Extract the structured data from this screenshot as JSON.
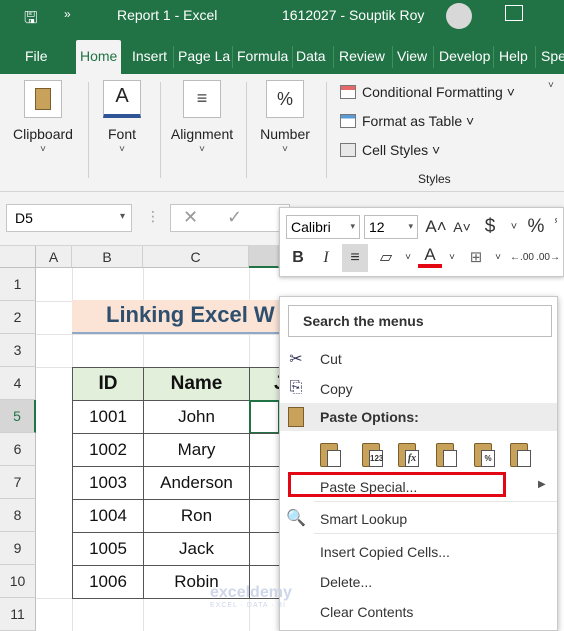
{
  "titlebar": {
    "doc_title": "Report 1  -  Excel",
    "user": "1612027 - Souptik Roy"
  },
  "tabs": [
    "File",
    "Home",
    "Insert",
    "Page La",
    "Formula",
    "Data",
    "Review",
    "View",
    "Develop",
    "Help",
    "Speci"
  ],
  "ribbon": {
    "clipboard": "Clipboard",
    "font": "Font",
    "alignment": "Alignment",
    "number": "Number",
    "conditional_formatting": "Conditional Formatting ˅",
    "format_as_table": "Format as Table ˅",
    "cell_styles": "Cell Styles ˅",
    "styles_group": "Styles",
    "number_icon": "%"
  },
  "namebox": {
    "value": "D5"
  },
  "columns": [
    "A",
    "B",
    "C"
  ],
  "column_d_partial": "",
  "rows": [
    "1",
    "2",
    "3",
    "4",
    "5",
    "6",
    "7",
    "8",
    "9",
    "10",
    "11"
  ],
  "banner": "Linking Excel W",
  "table": {
    "headers": [
      "ID",
      "Name",
      "J"
    ],
    "rows": [
      [
        "1001",
        "John"
      ],
      [
        "1002",
        "Mary"
      ],
      [
        "1003",
        "Anderson"
      ],
      [
        "1004",
        "Ron"
      ],
      [
        "1005",
        "Jack"
      ],
      [
        "1006",
        "Robin"
      ]
    ]
  },
  "mini_toolbar": {
    "font": "Calibri",
    "size": "12",
    "bold": "B",
    "italic": "I",
    "currency": "$",
    "percent": "%",
    "font_color_glyph": "A"
  },
  "context_menu": {
    "search": "Search the menus",
    "cut": "Cut",
    "copy": "Copy",
    "paste_options": "Paste Options:",
    "paste_special": "Paste Special...",
    "smart_lookup": "Smart Lookup",
    "insert_copied": "Insert Copied Cells...",
    "delete": "Delete...",
    "clear_contents": "Clear Contents",
    "paste_icon_labels": [
      "",
      "123",
      "fx",
      "",
      "%",
      ""
    ]
  },
  "watermark": {
    "name": "exceldemy",
    "tagline": "EXCEL · DATA · BI"
  },
  "colors": {
    "excel_green": "#217346",
    "highlight_red": "#e30613",
    "header_fill": "#e2efda",
    "banner_fill": "#fbe3d6"
  }
}
